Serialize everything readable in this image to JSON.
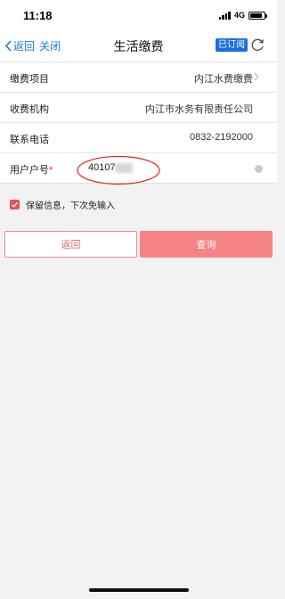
{
  "status_bar": {
    "time": "11:18",
    "network": "4G",
    "battery_level": 0.85
  },
  "nav": {
    "back_label": "返回",
    "close_label": "关闭",
    "title": "生活缴费",
    "subscribed_badge": "已订阅",
    "accent_color": "#1a7de0"
  },
  "form": {
    "rows": [
      {
        "label": "缴费项目",
        "value": "内江水费缴费"
      },
      {
        "label": "收费机构",
        "value": "内江市水务有限责任公司"
      },
      {
        "label": "联系电话",
        "value": "0832-2192000"
      }
    ],
    "account": {
      "label": "用户户号",
      "required_mark": "*",
      "value": "40107"
    }
  },
  "remember": {
    "label": "保留信息，下次免输入",
    "checked": true
  },
  "buttons": {
    "back_label": "返回",
    "query_label": "查询",
    "primary_color": "#f58383"
  }
}
